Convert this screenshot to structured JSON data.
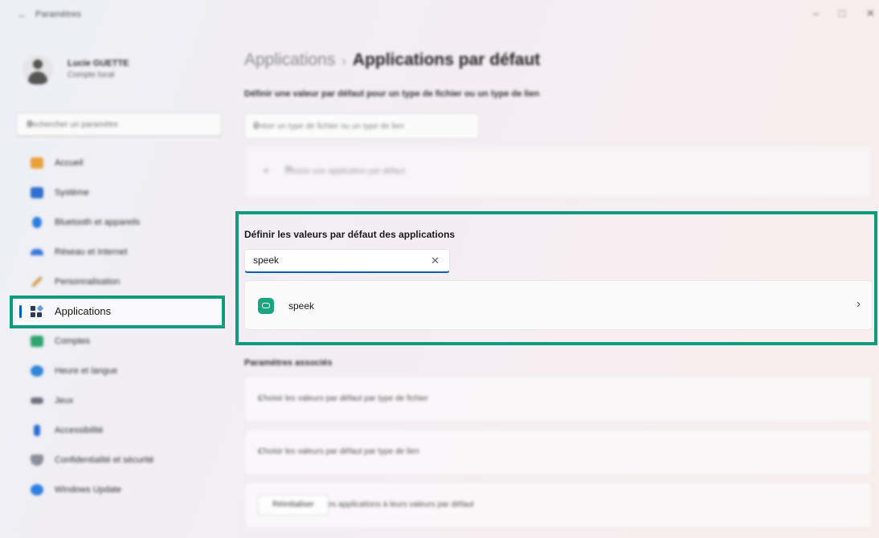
{
  "titlebar": {
    "back_icon": "arrow-left-icon",
    "title": "Paramètres",
    "minimize": "–",
    "maximize": "□",
    "close": "✕"
  },
  "sidebar": {
    "profile": {
      "name": "Lucie GUETTE",
      "account_type": "Compte local"
    },
    "search": {
      "placeholder": "Rechercher un paramètre"
    },
    "items": [
      {
        "label": "Accueil",
        "icon": "home-icon",
        "color": "#e9a23b"
      },
      {
        "label": "Système",
        "icon": "monitor-icon",
        "color": "#2f6fd0"
      },
      {
        "label": "Bluetooth et appareils",
        "icon": "bluetooth-icon",
        "color": "#2b7de0"
      },
      {
        "label": "Réseau et Internet",
        "icon": "wifi-icon",
        "color": "#3a78d8"
      },
      {
        "label": "Personnalisation",
        "icon": "brush-icon",
        "color": "#d09a4a"
      },
      {
        "label": "Applications",
        "icon": "apps-icon",
        "color": "#2b3a55"
      },
      {
        "label": "Comptes",
        "icon": "person-icon",
        "color": "#2ea36e"
      },
      {
        "label": "Heure et langue",
        "icon": "globe-clock-icon",
        "color": "#2f86d6"
      },
      {
        "label": "Jeux",
        "icon": "gamepad-icon",
        "color": "#6b7080"
      },
      {
        "label": "Accessibilité",
        "icon": "accessibility-icon",
        "color": "#2b6ed6"
      },
      {
        "label": "Confidentialité et sécurité",
        "icon": "shield-icon",
        "color": "#8a8f99"
      },
      {
        "label": "Windows Update",
        "icon": "windows-update-icon",
        "color": "#2d7fe0"
      }
    ],
    "active_index": 5
  },
  "main": {
    "breadcrumb_parent": "Applications",
    "breadcrumb_sep": "›",
    "breadcrumb_current": "Applications par défaut",
    "subtitle": "Définir une valeur par défaut pour un type de fichier ou un type de lien",
    "filetype_search_placeholder": "Entrer un type de fichier ou un type de lien",
    "choose_app_label": "Choisir une application par défaut",
    "section_title": "Définir les valeurs par défaut des applications",
    "app_search_value": "speek",
    "app_search_clear": "✕",
    "result": {
      "name": "speek",
      "icon": "speek-app-icon",
      "chevron": "›"
    },
    "related_title": "Paramètres associés",
    "related": [
      {
        "label": "Choisir les valeurs par défaut par type de fichier",
        "chevron": "›"
      },
      {
        "label": "Choisir les valeurs par défaut par type de lien",
        "chevron": "›"
      },
      {
        "label": "Réinitialiser toutes les applications à leurs valeurs par défaut",
        "button": "Réinitialiser"
      }
    ]
  },
  "colors": {
    "highlight": "#0e9c7e",
    "accent": "#005fb8"
  }
}
